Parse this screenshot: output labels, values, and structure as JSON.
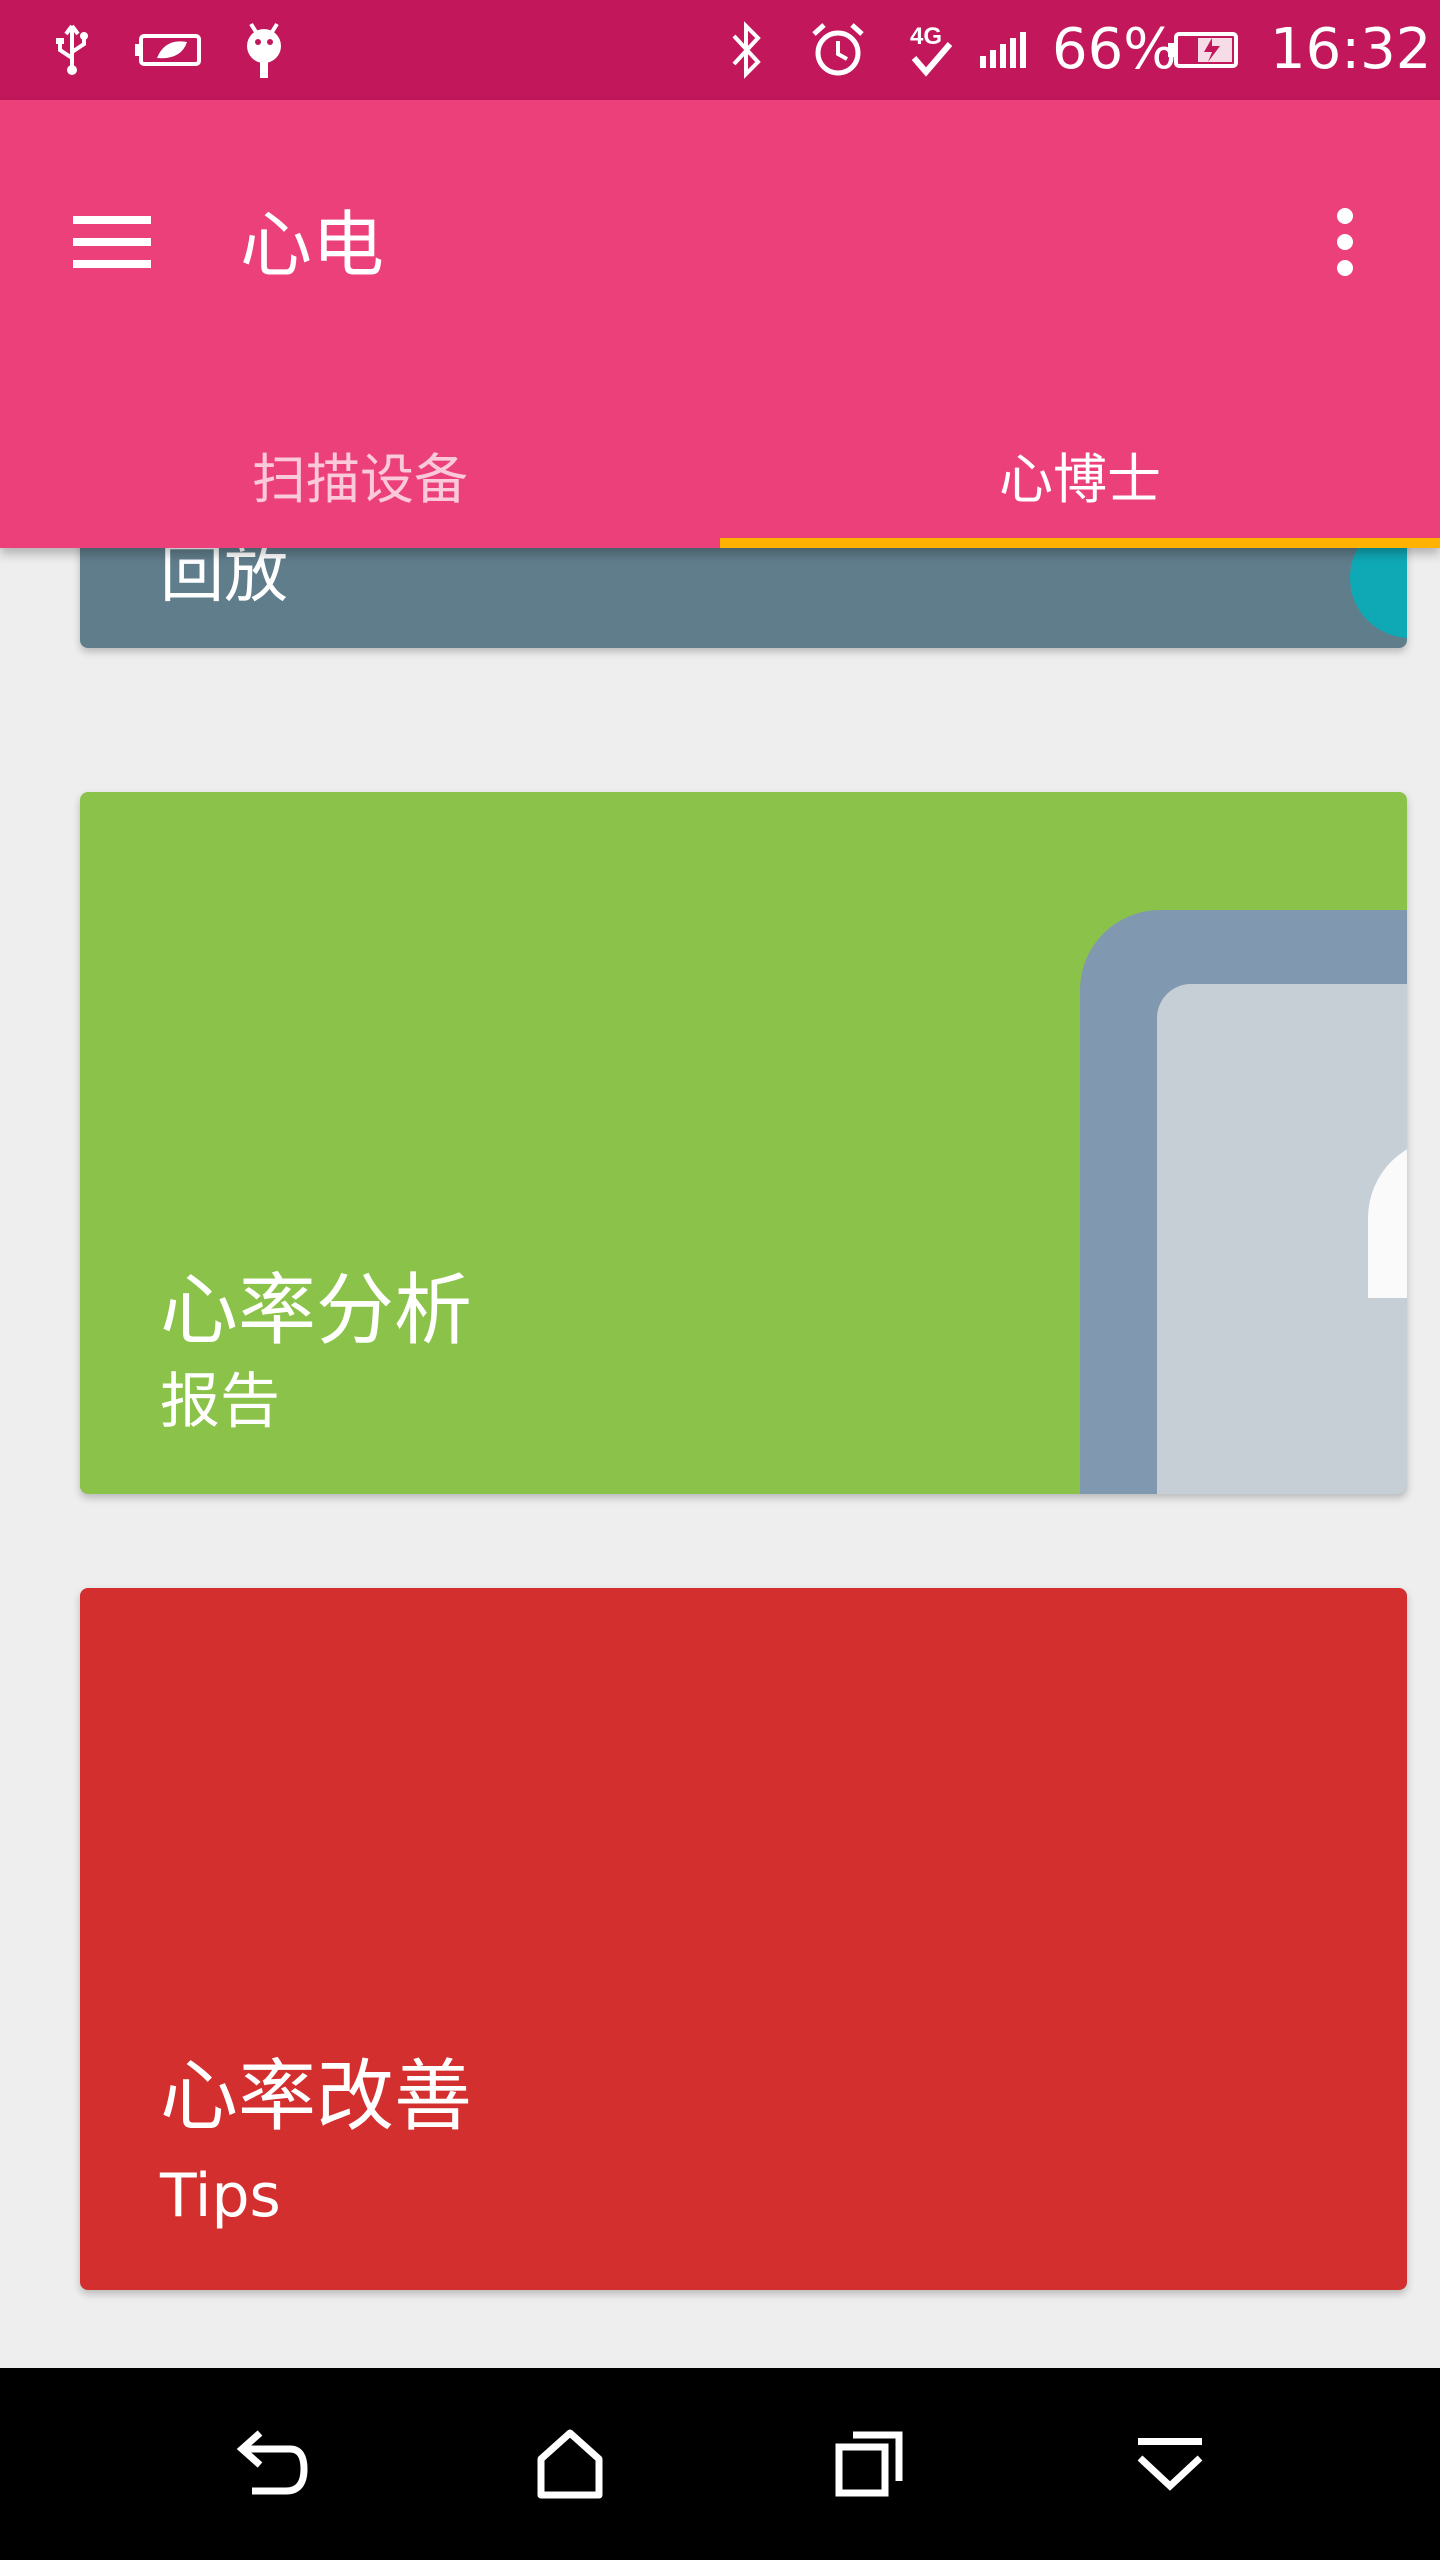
{
  "status_bar": {
    "battery_percent": "66%",
    "time": "16:32",
    "network_label": "4G",
    "icons": [
      "usb-icon",
      "battery-saver-icon",
      "android-debug-icon",
      "bluetooth-icon",
      "alarm-icon",
      "4g-icon",
      "signal-icon",
      "battery-charging-icon"
    ]
  },
  "app_bar": {
    "title": "心电",
    "menu_icon": "hamburger-menu-icon",
    "overflow_icon": "more-vert-icon",
    "tabs": [
      {
        "label": "扫描设备",
        "selected": false
      },
      {
        "label": "心博士",
        "selected": true
      }
    ],
    "indicator_color": "#ffb300"
  },
  "cards": [
    {
      "title": "回放",
      "color": "#607d8b"
    },
    {
      "title": "心率分析",
      "subtitle": "报告",
      "color": "#8bc34a"
    },
    {
      "title": "心率改善",
      "subtitle": "Tips",
      "color": "#d32f2f"
    }
  ],
  "nav_bar": {
    "buttons": [
      "back-icon",
      "home-icon",
      "recents-icon",
      "hide-nav-icon"
    ]
  },
  "colors": {
    "status_bar": "#c2185b",
    "app_bar": "#ec407a",
    "background": "#eeeeee"
  }
}
